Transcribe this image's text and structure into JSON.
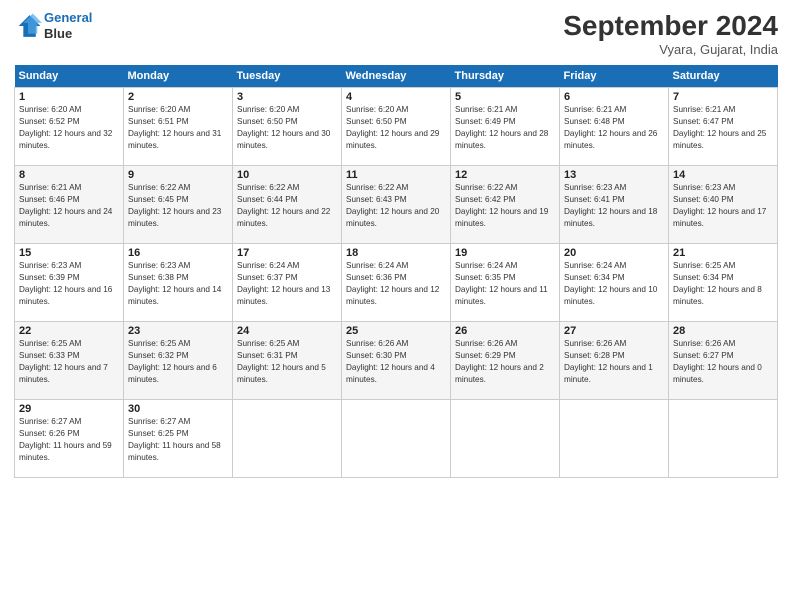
{
  "header": {
    "logo_line1": "General",
    "logo_line2": "Blue",
    "month_title": "September 2024",
    "location": "Vyara, Gujarat, India"
  },
  "days_of_week": [
    "Sunday",
    "Monday",
    "Tuesday",
    "Wednesday",
    "Thursday",
    "Friday",
    "Saturday"
  ],
  "weeks": [
    [
      {
        "day": "1",
        "sunrise": "6:20 AM",
        "sunset": "6:52 PM",
        "daylight": "12 hours and 32 minutes."
      },
      {
        "day": "2",
        "sunrise": "6:20 AM",
        "sunset": "6:51 PM",
        "daylight": "12 hours and 31 minutes."
      },
      {
        "day": "3",
        "sunrise": "6:20 AM",
        "sunset": "6:50 PM",
        "daylight": "12 hours and 30 minutes."
      },
      {
        "day": "4",
        "sunrise": "6:20 AM",
        "sunset": "6:50 PM",
        "daylight": "12 hours and 29 minutes."
      },
      {
        "day": "5",
        "sunrise": "6:21 AM",
        "sunset": "6:49 PM",
        "daylight": "12 hours and 28 minutes."
      },
      {
        "day": "6",
        "sunrise": "6:21 AM",
        "sunset": "6:48 PM",
        "daylight": "12 hours and 26 minutes."
      },
      {
        "day": "7",
        "sunrise": "6:21 AM",
        "sunset": "6:47 PM",
        "daylight": "12 hours and 25 minutes."
      }
    ],
    [
      {
        "day": "8",
        "sunrise": "6:21 AM",
        "sunset": "6:46 PM",
        "daylight": "12 hours and 24 minutes."
      },
      {
        "day": "9",
        "sunrise": "6:22 AM",
        "sunset": "6:45 PM",
        "daylight": "12 hours and 23 minutes."
      },
      {
        "day": "10",
        "sunrise": "6:22 AM",
        "sunset": "6:44 PM",
        "daylight": "12 hours and 22 minutes."
      },
      {
        "day": "11",
        "sunrise": "6:22 AM",
        "sunset": "6:43 PM",
        "daylight": "12 hours and 20 minutes."
      },
      {
        "day": "12",
        "sunrise": "6:22 AM",
        "sunset": "6:42 PM",
        "daylight": "12 hours and 19 minutes."
      },
      {
        "day": "13",
        "sunrise": "6:23 AM",
        "sunset": "6:41 PM",
        "daylight": "12 hours and 18 minutes."
      },
      {
        "day": "14",
        "sunrise": "6:23 AM",
        "sunset": "6:40 PM",
        "daylight": "12 hours and 17 minutes."
      }
    ],
    [
      {
        "day": "15",
        "sunrise": "6:23 AM",
        "sunset": "6:39 PM",
        "daylight": "12 hours and 16 minutes."
      },
      {
        "day": "16",
        "sunrise": "6:23 AM",
        "sunset": "6:38 PM",
        "daylight": "12 hours and 14 minutes."
      },
      {
        "day": "17",
        "sunrise": "6:24 AM",
        "sunset": "6:37 PM",
        "daylight": "12 hours and 13 minutes."
      },
      {
        "day": "18",
        "sunrise": "6:24 AM",
        "sunset": "6:36 PM",
        "daylight": "12 hours and 12 minutes."
      },
      {
        "day": "19",
        "sunrise": "6:24 AM",
        "sunset": "6:35 PM",
        "daylight": "12 hours and 11 minutes."
      },
      {
        "day": "20",
        "sunrise": "6:24 AM",
        "sunset": "6:34 PM",
        "daylight": "12 hours and 10 minutes."
      },
      {
        "day": "21",
        "sunrise": "6:25 AM",
        "sunset": "6:34 PM",
        "daylight": "12 hours and 8 minutes."
      }
    ],
    [
      {
        "day": "22",
        "sunrise": "6:25 AM",
        "sunset": "6:33 PM",
        "daylight": "12 hours and 7 minutes."
      },
      {
        "day": "23",
        "sunrise": "6:25 AM",
        "sunset": "6:32 PM",
        "daylight": "12 hours and 6 minutes."
      },
      {
        "day": "24",
        "sunrise": "6:25 AM",
        "sunset": "6:31 PM",
        "daylight": "12 hours and 5 minutes."
      },
      {
        "day": "25",
        "sunrise": "6:26 AM",
        "sunset": "6:30 PM",
        "daylight": "12 hours and 4 minutes."
      },
      {
        "day": "26",
        "sunrise": "6:26 AM",
        "sunset": "6:29 PM",
        "daylight": "12 hours and 2 minutes."
      },
      {
        "day": "27",
        "sunrise": "6:26 AM",
        "sunset": "6:28 PM",
        "daylight": "12 hours and 1 minute."
      },
      {
        "day": "28",
        "sunrise": "6:26 AM",
        "sunset": "6:27 PM",
        "daylight": "12 hours and 0 minutes."
      }
    ],
    [
      {
        "day": "29",
        "sunrise": "6:27 AM",
        "sunset": "6:26 PM",
        "daylight": "11 hours and 59 minutes."
      },
      {
        "day": "30",
        "sunrise": "6:27 AM",
        "sunset": "6:25 PM",
        "daylight": "11 hours and 58 minutes."
      },
      null,
      null,
      null,
      null,
      null
    ]
  ]
}
